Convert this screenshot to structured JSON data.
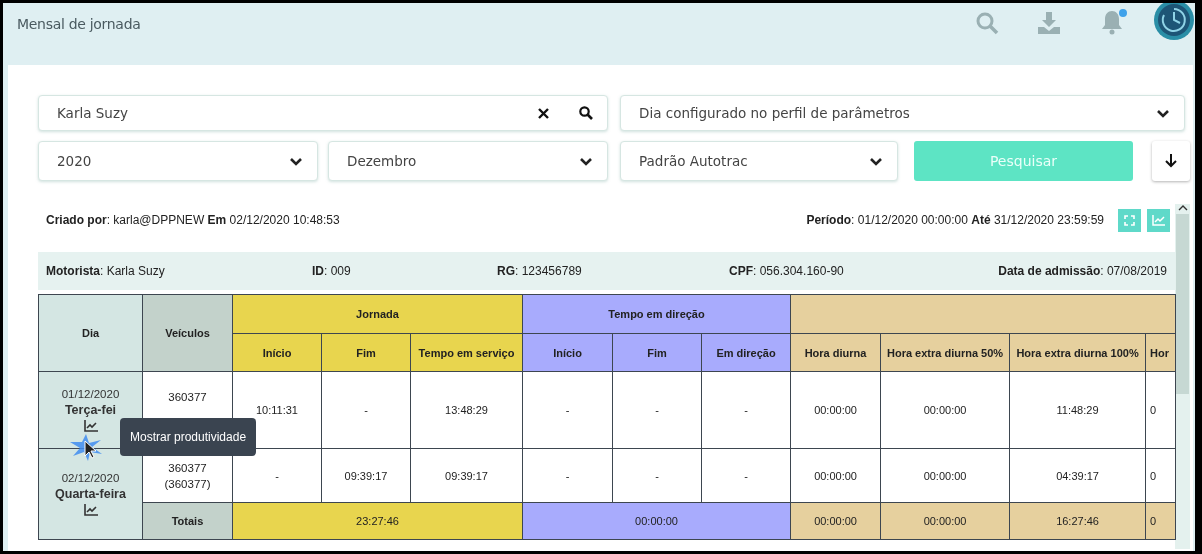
{
  "header": {
    "title": "Mensal de jornada",
    "notification": true
  },
  "filters": {
    "driver": {
      "value": "Karla Suzy"
    },
    "day_mode": {
      "value": "Dia configurado no perfil de parâmetros"
    },
    "year": {
      "value": "2020"
    },
    "month": {
      "value": "Dezembro"
    },
    "profile": {
      "value": "Padrão Autotrac"
    },
    "search_button": "Pesquisar"
  },
  "report": {
    "created": "**Criado por**: karla@DPPNEW **Em** 02/12/2020 10:48:53",
    "period": "**Período**: 01/12/2020 00:00:00 **Até** 31/12/2020 23:59:59",
    "driver_info": [
      "**Motorista**: Karla Suzy",
      "**ID**: 009",
      "**RG**: 123456789",
      "**CPF**: 056.304.160-90",
      "**Data de admissão**: 07/08/2019"
    ]
  },
  "table": {
    "day_header": "Dia",
    "vehicles_header": "Veículos",
    "totals_label": "Totais",
    "groups": [
      {
        "label": "Jornada",
        "color": "#e8d54e",
        "columns": [
          "Início",
          "Fim",
          "Tempo em serviço"
        ],
        "totals": [
          "23:27:46"
        ]
      },
      {
        "label": "Tempo em direção",
        "color": "#a8abfd",
        "columns": [
          "Início",
          "Fim",
          "Em direção"
        ],
        "totals": [
          "00:00:00"
        ]
      },
      {
        "color": "#e6d09e",
        "columns": [
          "Hora diurna",
          "Hora extra diurna 50%",
          "Hora extra diurna 100%",
          "Hor"
        ],
        "totals": [
          "00:00:00",
          "00:00:00",
          "16:27:46",
          "0"
        ]
      }
    ],
    "rows": [
      {
        "date": "01/12/2020",
        "weekday": "Terça-fei",
        "vehicles": [
          "360377"
        ],
        "tooltip": "Mostrar produtividade",
        "cells": [
          "10:11:31",
          "-",
          "13:48:29",
          "-",
          "-",
          "-",
          "00:00:00",
          "00:00:00",
          "11:48:29",
          "0"
        ]
      },
      {
        "date": "02/12/2020",
        "weekday": "Quarta-feira",
        "vehicles": [
          "360377",
          "(360377)"
        ],
        "cells": [
          "-",
          "09:39:17",
          "09:39:17",
          "-",
          "-",
          "-",
          "00:00:00",
          "00:00:00",
          "04:39:17",
          "0"
        ]
      }
    ]
  }
}
